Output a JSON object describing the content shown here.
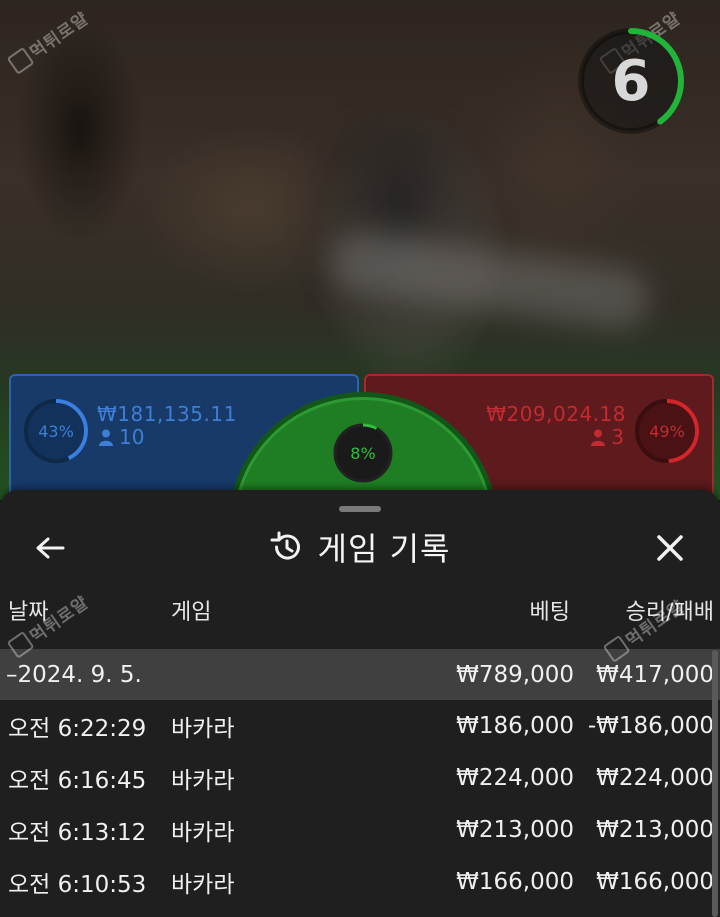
{
  "watermark": {
    "text": "먹튀로얄"
  },
  "timer": {
    "value": "6",
    "progress": 0.4
  },
  "player": {
    "percent_label": "43%",
    "percent": 0.43,
    "amount": "₩181,135.11",
    "count": "10",
    "color": "#3f7ed6"
  },
  "banker": {
    "percent_label": "49%",
    "percent": 0.49,
    "amount": "₩209,024.18",
    "count": "3",
    "color": "#c12b31"
  },
  "tie": {
    "percent_label": "8%",
    "percent": 0.08,
    "color": "#2fbf3a"
  },
  "sheet": {
    "title": "게임 기록",
    "back_icon": "arrow-left-icon",
    "history_icon": "history-icon",
    "close_icon": "close-icon"
  },
  "table": {
    "headers": {
      "date": "날짜",
      "game": "게임",
      "bet": "베팅",
      "winloss": "승리/패배"
    },
    "summary": {
      "date": "–2024. 9. 5.",
      "bet": "₩789,000",
      "winloss": "₩417,000"
    },
    "rows": [
      {
        "time": "오전 6:22:29",
        "game": "바카라",
        "bet": "₩186,000",
        "winloss": "-₩186,000"
      },
      {
        "time": "오전 6:16:45",
        "game": "바카라",
        "bet": "₩224,000",
        "winloss": "₩224,000"
      },
      {
        "time": "오전 6:13:12",
        "game": "바카라",
        "bet": "₩213,000",
        "winloss": "₩213,000"
      },
      {
        "time": "오전 6:10:53",
        "game": "바카라",
        "bet": "₩166,000",
        "winloss": "₩166,000"
      }
    ]
  }
}
